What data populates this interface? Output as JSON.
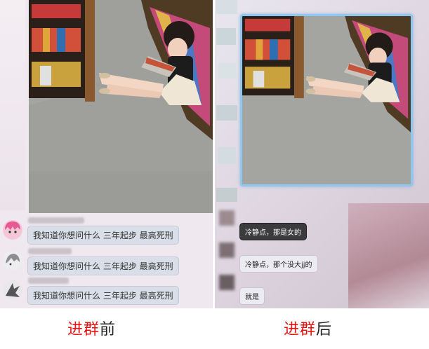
{
  "left_panel": {
    "messages": [
      {
        "text": "我知道你想问什么  三年起步  最高死刑",
        "avatar_color": "#e55a93"
      },
      {
        "text": "我知道你想问什么  三年起步  最高死刑",
        "avatar_color": "#8d8d90"
      },
      {
        "text": "我知道你想问什么  三年起步  最高死刑",
        "avatar_color": "#555558"
      }
    ]
  },
  "right_panel": {
    "messages": [
      {
        "text": "冷静点，那是女的",
        "style": "dark"
      },
      {
        "text": "冷静点，那个没大jj的",
        "style": "light"
      },
      {
        "text": "就是",
        "style": "light"
      }
    ]
  },
  "captions": {
    "before": {
      "red": "进群",
      "black": "前"
    },
    "after": {
      "red": "进群",
      "black": "后"
    }
  },
  "colors": {
    "caption_red": "#e01414",
    "bubble_bg": "#d9dee9",
    "photo_frame": "#8ec7ef"
  }
}
